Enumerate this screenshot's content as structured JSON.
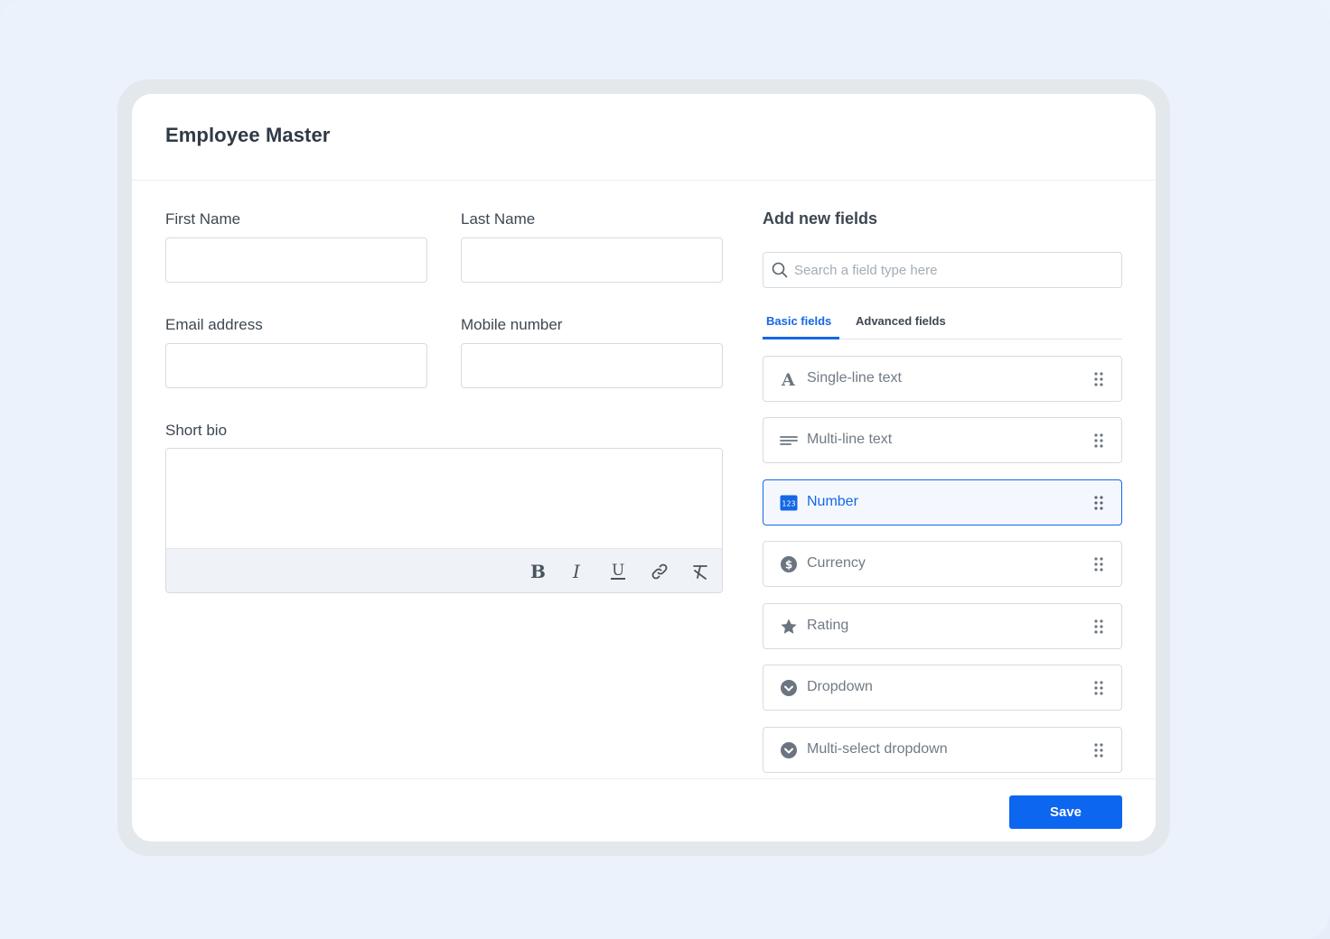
{
  "page": {
    "title": "Employee Master"
  },
  "form": {
    "first_name": {
      "label": "First Name",
      "value": ""
    },
    "last_name": {
      "label": "Last Name",
      "value": ""
    },
    "email": {
      "label": "Email address",
      "value": ""
    },
    "mobile": {
      "label": "Mobile number",
      "value": ""
    },
    "short_bio": {
      "label": "Short bio",
      "value": ""
    },
    "toolbar": [
      {
        "icon": "bold-icon"
      },
      {
        "icon": "italic-icon"
      },
      {
        "icon": "underline-icon"
      },
      {
        "icon": "link-icon"
      },
      {
        "icon": "clear-format-icon"
      }
    ]
  },
  "add_fields": {
    "title": "Add new fields",
    "search": {
      "placeholder": "Search a field type here",
      "value": ""
    },
    "tabs": [
      {
        "label": "Basic fields",
        "active": true
      },
      {
        "label": "Advanced fields",
        "active": false
      }
    ],
    "items": [
      {
        "label": "Single-line text",
        "icon": "text-a-icon",
        "selected": false
      },
      {
        "label": "Multi-line text",
        "icon": "lines-icon",
        "selected": false
      },
      {
        "label": "Number",
        "icon": "number-123-icon",
        "icon_text": "123",
        "selected": true
      },
      {
        "label": "Currency",
        "icon": "dollar-icon",
        "selected": false
      },
      {
        "label": "Rating",
        "icon": "star-icon",
        "selected": false
      },
      {
        "label": "Dropdown",
        "icon": "chevron-circle-icon",
        "selected": false
      },
      {
        "label": "Multi-select dropdown",
        "icon": "chevron-circle-icon",
        "selected": false
      }
    ]
  },
  "footer": {
    "save_label": "Save"
  },
  "colors": {
    "accent": "#1467e6",
    "button": "#0d66f0",
    "text": "#3d4752",
    "muted": "#707a85"
  }
}
